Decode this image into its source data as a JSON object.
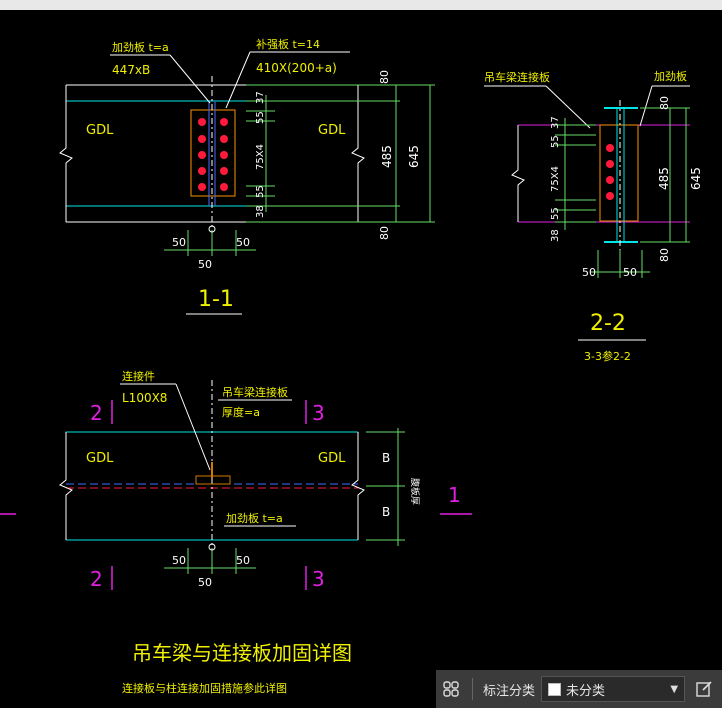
{
  "drawing": {
    "section_1_1": {
      "stiffener_label": "加劲板  t=a",
      "stiffener_dim": "447xB",
      "patch_label": "补强板  t=14",
      "patch_dim": "410X(200+a)",
      "gdl_left": "GDL",
      "gdl_right": "GDL",
      "dims_left": [
        "37",
        "55",
        "75X4",
        "55",
        "38"
      ],
      "dim_80_top": "80",
      "dim_485": "485",
      "dim_645": "645",
      "dim_80_bot": "80",
      "bottom_dims": [
        "50",
        "50",
        "50"
      ],
      "title": "1-1"
    },
    "section_2_2": {
      "beam_label": "吊车梁连接板",
      "stiffener_label": "加劲板",
      "dims_left": [
        "37",
        "55",
        "75X4",
        "55",
        "38"
      ],
      "dim_80_top": "80",
      "dim_485": "485",
      "dim_645": "645",
      "dim_80_bot": "80",
      "bottom_dims": [
        "50",
        "50"
      ],
      "title": "2-2",
      "subtitle": "3-3参2-2"
    },
    "plan": {
      "connector_label": "连接件",
      "connector_dim": "L100X8",
      "beam_plate_label": "吊车梁连接板",
      "thickness_label": "厚度=a",
      "stiffener_label": "加劲板  t=a",
      "gdl_left": "GDL",
      "gdl_right": "GDL",
      "cut_2": "2",
      "cut_3": "3",
      "cut_1": "1",
      "dim_B_top": "B",
      "dim_B_bot": "B",
      "flange_label": "腹板厚",
      "bottom_dims": [
        "50",
        "50",
        "50"
      ]
    },
    "main_title": "吊车梁与连接板加固详图",
    "note": "连接板与柱连接加固措施参此详图"
  },
  "colors": {
    "cyan": "#00e5e5",
    "yellow": "#f0f000",
    "white": "#ffffff",
    "red": "#ff1a3c",
    "magenta": "#e020e0",
    "green": "#66dd66",
    "orange": "#d27a00",
    "blue": "#4a6bff"
  },
  "toolbar": {
    "grid_icon": "grid-icon",
    "label": "标注分类",
    "dropdown_value": "未分类",
    "edit_icon": "edit-icon"
  }
}
